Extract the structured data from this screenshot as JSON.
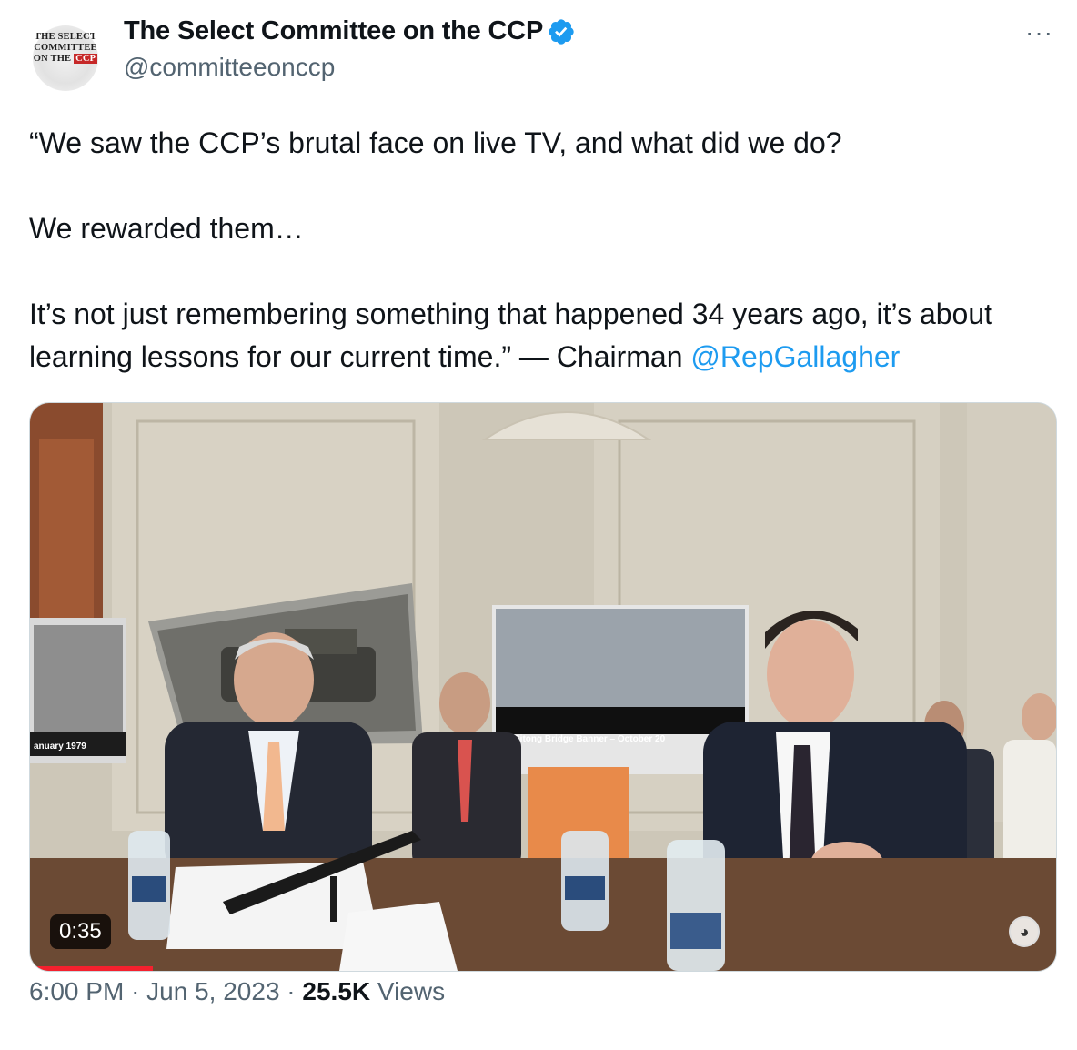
{
  "author": {
    "display_name": "The Select Committee on the CCP",
    "handle": "@committeeonccp",
    "avatar_logo": {
      "line1": "THE SELECT",
      "line2": "COMMITTEE",
      "line3_prefix": "ON THE",
      "line3_tag": "CCP"
    },
    "verified": true,
    "verified_color": "#1d9bf0"
  },
  "menu": {
    "more_label": "···"
  },
  "tweet": {
    "paragraph1": "“We saw the CCP’s brutal face on live TV, and what did we do?",
    "paragraph2": "We rewarded them…",
    "paragraph3": "It’s not just remembering something that happened 34 years ago, it’s about learning lessons for our current time.” — Chairman ",
    "mention": "@RepGallagher",
    "mention_color": "#1d9bf0"
  },
  "media": {
    "duration": "0:35",
    "progress_fraction": 0.12,
    "progress_color": "#f4212e",
    "board_left_caption": "anuary 1979",
    "board_right_caption": "Sitong Bridge Banner – October 20"
  },
  "meta": {
    "time": "6:00 PM",
    "separator1": "·",
    "date": "Jun 5, 2023",
    "separator2": "·",
    "views_count": "25.5K",
    "views_label": "Views"
  }
}
